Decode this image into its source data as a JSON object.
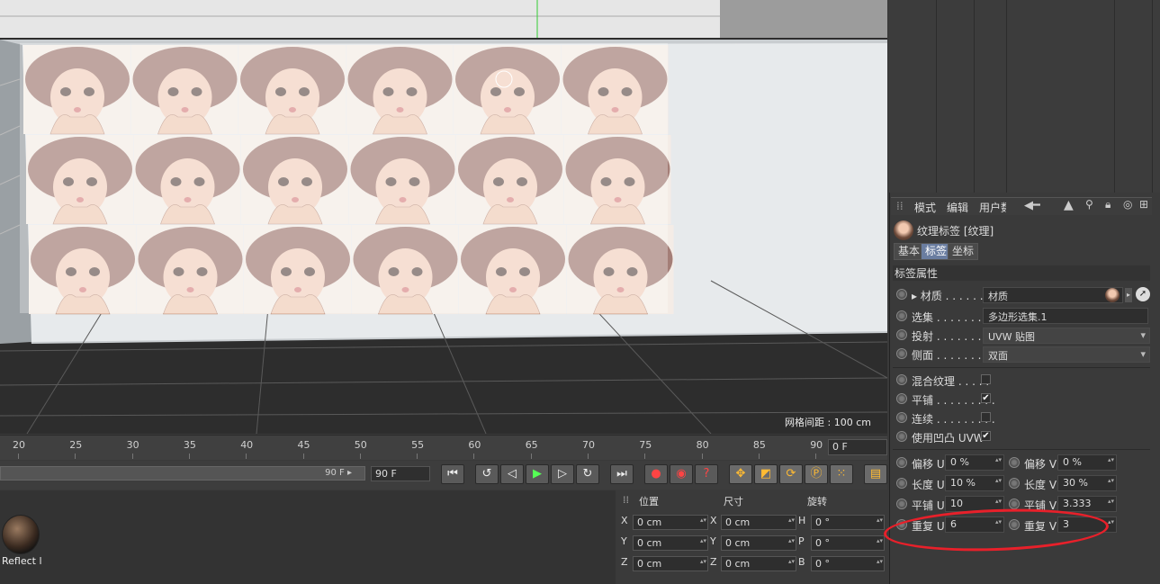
{
  "viewport": {
    "grid_spacing_label": "网格间距 : 100 cm",
    "tiles": {
      "rows": 3,
      "cols": 6
    }
  },
  "timeline": {
    "ticks": [
      "20",
      "25",
      "30",
      "35",
      "40",
      "45",
      "50",
      "55",
      "60",
      "65",
      "70",
      "75",
      "80",
      "85",
      "90"
    ],
    "current_frame": "0 F",
    "scrubber_end": "90 F",
    "end_frame": "90 F"
  },
  "transport": {
    "buttons": [
      "go-start",
      "prev-key",
      "prev-frame",
      "play",
      "next-frame",
      "next-key",
      "go-end",
      "record",
      "autokey",
      "keyframe-help",
      "move",
      "scale",
      "rotate",
      "param",
      "dots",
      "film"
    ]
  },
  "material": {
    "name": "Reflect l"
  },
  "coords": {
    "headers": {
      "position": "位置",
      "size": "尺寸",
      "rotation": "旋转"
    },
    "rows": [
      {
        "axis": "X",
        "pos": "0 cm",
        "saxis": "X",
        "size": "0 cm",
        "raxis": "H",
        "rot": "0 °"
      },
      {
        "axis": "Y",
        "pos": "0 cm",
        "saxis": "Y",
        "size": "0 cm",
        "raxis": "P",
        "rot": "0 °"
      },
      {
        "axis": "Z",
        "pos": "0 cm",
        "saxis": "Z",
        "size": "0 cm",
        "raxis": "B",
        "rot": "0 °"
      }
    ]
  },
  "attributes": {
    "menu": {
      "mode": "模式",
      "edit": "编辑",
      "user": "用户数"
    },
    "tag_title": "纹理标签 [纹理]",
    "tabs": {
      "basic": "基本",
      "tag": "标签",
      "coord": "坐标"
    },
    "section": "标签属性",
    "material": {
      "label": "材质 . . . . . . .",
      "value": "材质"
    },
    "selection": {
      "label": "选集 . . . . . . . . .",
      "value": "多边形选集.1"
    },
    "projection": {
      "label": "投射 . . . . . . . . .",
      "value": "UVW 贴图"
    },
    "side": {
      "label": "侧面 . . . . . . . . .",
      "value": "双面"
    },
    "mix": {
      "label": "混合纹理 . . . . .",
      "checked": false
    },
    "tile": {
      "label": "平铺 . . . . . . . . .",
      "checked": true
    },
    "seamless": {
      "label": "连续 . . . . . . . . .",
      "checked": false
    },
    "bump": {
      "label": "使用凹凸 UVW",
      "checked": true
    },
    "offset_u": {
      "label": "偏移 U",
      "value": "0 %"
    },
    "offset_v": {
      "label": "偏移 V",
      "value": "0 %"
    },
    "length_u": {
      "label": "长度 U",
      "value": "10 %"
    },
    "length_v": {
      "label": "长度 V",
      "value": "30 %"
    },
    "tiles_u": {
      "label": "平铺 U",
      "value": "10"
    },
    "tiles_v": {
      "label": "平铺 V",
      "value": "3.333"
    },
    "repeat_u": {
      "label": "重复 U",
      "value": "6"
    },
    "repeat_v": {
      "label": "重复 V",
      "value": "3"
    }
  },
  "colors": {
    "annotation": "#e8202a",
    "accent": "#6a7da0"
  }
}
